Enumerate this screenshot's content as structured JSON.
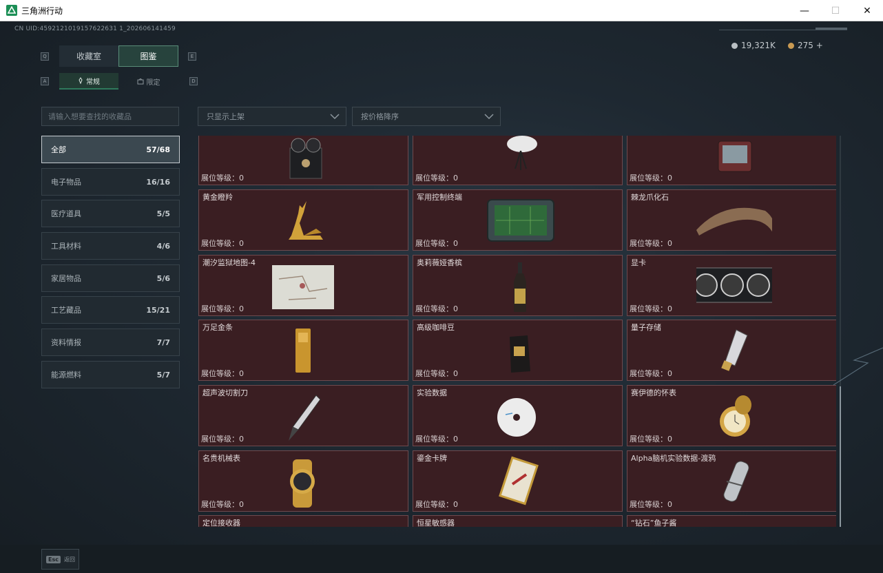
{
  "window": {
    "title": "三角洲行动",
    "minimize": "—",
    "maximize": "☐",
    "close": "✕"
  },
  "uid": "CN UID:4592121019157622631 1_202606141459",
  "currency": [
    {
      "icon": "silver-coin-icon",
      "value": "19,321K",
      "color": "#b9bfc3"
    },
    {
      "icon": "gold-coin-icon",
      "value": "275 +",
      "color": "#c99a52"
    }
  ],
  "tabs": {
    "key_left": "Q",
    "key_right": "E",
    "items": [
      "收藏室",
      "图鉴"
    ],
    "active": 1
  },
  "subtabs": {
    "key_left": "A",
    "key_right": "D",
    "items": [
      "常规",
      "限定"
    ],
    "active": 0
  },
  "search": {
    "placeholder": "请输入想要查找的收藏品"
  },
  "filters": {
    "listing": "只显示上架",
    "sort": "按价格降序"
  },
  "categories": [
    {
      "label": "全部",
      "count": "57/68"
    },
    {
      "label": "电子物品",
      "count": "16/16"
    },
    {
      "label": "医疗道具",
      "count": "5/5"
    },
    {
      "label": "工具材料",
      "count": "4/6"
    },
    {
      "label": "家居物品",
      "count": "5/6"
    },
    {
      "label": "工艺藏品",
      "count": "15/21"
    },
    {
      "label": "资料情报",
      "count": "7/7"
    },
    {
      "label": "能源燃料",
      "count": "5/7"
    }
  ],
  "level_label": "展位等级：0",
  "items": [
    {
      "name": "",
      "icon": "film-projector-icon"
    },
    {
      "name": "",
      "icon": "satellite-dish-icon"
    },
    {
      "name": "",
      "icon": "tablet-device-icon"
    },
    {
      "name": "黄金瞪羚",
      "icon": "golden-gazelle-icon"
    },
    {
      "name": "军用控制终端",
      "icon": "control-terminal-icon"
    },
    {
      "name": "棘龙爪化石",
      "icon": "claw-fossil-icon"
    },
    {
      "name": "潮汐监狱地图-4",
      "icon": "map-icon"
    },
    {
      "name": "奥莉薇娅香槟",
      "icon": "champagne-icon"
    },
    {
      "name": "显卡",
      "icon": "graphics-card-icon"
    },
    {
      "name": "万足金条",
      "icon": "gold-bar-icon"
    },
    {
      "name": "高级咖啡豆",
      "icon": "coffee-bag-icon"
    },
    {
      "name": "量子存储",
      "icon": "usb-drive-icon"
    },
    {
      "name": "超声波切割刀",
      "icon": "cutting-pen-icon"
    },
    {
      "name": "实验数据",
      "icon": "disc-icon"
    },
    {
      "name": "赛伊德的怀表",
      "icon": "pocket-watch-icon"
    },
    {
      "name": "名贵机械表",
      "icon": "wristwatch-icon"
    },
    {
      "name": "鎏金卡牌",
      "icon": "gilded-card-icon"
    },
    {
      "name": "Alpha脑机实验数据-渡鸦",
      "icon": "data-capsule-icon"
    },
    {
      "name": "定位接收器",
      "icon": "receiver-icon"
    },
    {
      "name": "恒星敏感器",
      "icon": "sensor-icon"
    },
    {
      "name": "“钻石”鱼子酱",
      "icon": "caviar-icon"
    }
  ],
  "back": {
    "key": "Esc",
    "label": "返回"
  }
}
